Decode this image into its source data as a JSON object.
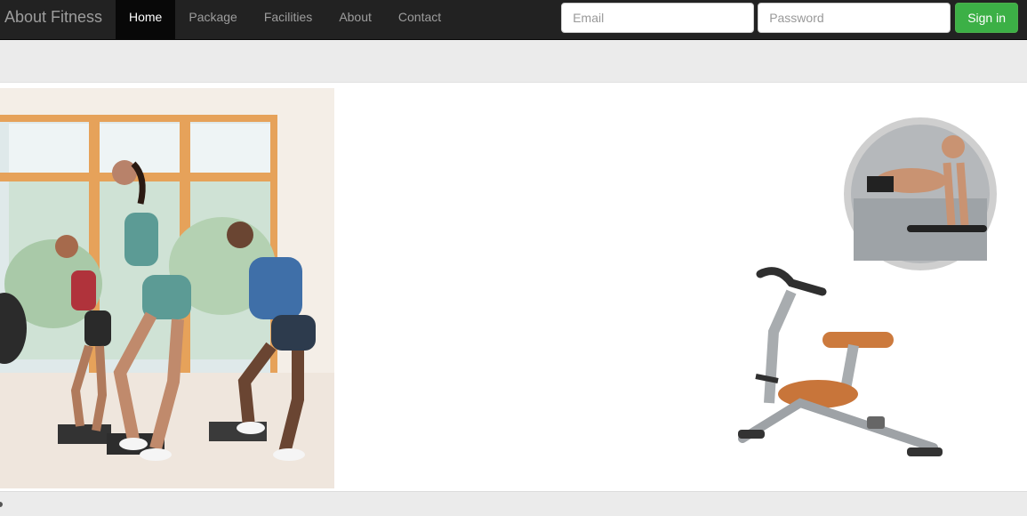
{
  "navbar": {
    "brand": "About Fitness",
    "items": [
      {
        "label": "Home",
        "active": true
      },
      {
        "label": "Package",
        "active": false
      },
      {
        "label": "Facilities",
        "active": false
      },
      {
        "label": "About",
        "active": false
      },
      {
        "label": "Contact",
        "active": false
      }
    ]
  },
  "signin": {
    "email_placeholder": "Email",
    "password_placeholder": "Password",
    "button_label": "Sign in"
  },
  "colors": {
    "navbar_bg": "#222222",
    "signin_button": "#3cb046",
    "page_bg": "#ebebeb"
  }
}
